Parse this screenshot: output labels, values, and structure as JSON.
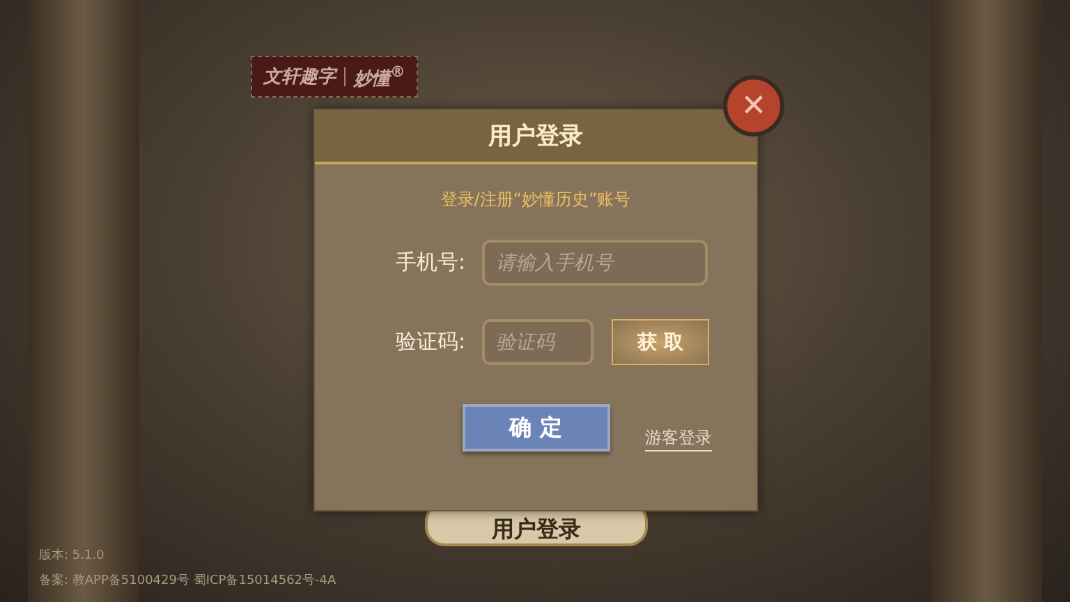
{
  "logo": {
    "brand": "文轩趣字",
    "product": "妙懂$^{®}$"
  },
  "background_button": {
    "label": "用户登录"
  },
  "dialog": {
    "title": "用户登录",
    "subtitle": "登录/注册“妙懂历史”账号",
    "close": {
      "label": "✕"
    },
    "fields": [
      {
        "kind": "phone",
        "label": "手机号:",
        "placeholder": "请输入手机号"
      },
      {
        "kind": "code",
        "label": "验证码:",
        "placeholder": "验证码",
        "button": "获 取"
      }
    ],
    "confirm": "确 定",
    "guest_link": "游客登录"
  },
  "footer": {
    "version": "版本: 5.1.0",
    "record": "备案: 教APP备5100429号  蜀ICP备15014562号-4A"
  }
}
